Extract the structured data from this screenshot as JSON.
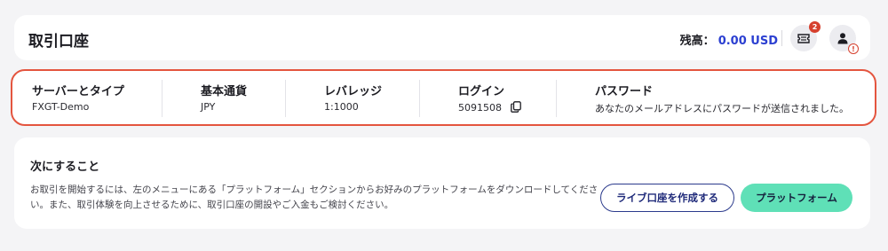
{
  "header": {
    "title": "取引口座",
    "balance_label": "残高：",
    "balance_amount": "0.00 USD",
    "notification_count": "2",
    "account_alert": "!",
    "colors": {
      "accent": "#2b3fd1",
      "badge": "#d6402e"
    }
  },
  "account": {
    "highlight_color": "#e4553f",
    "fields": [
      {
        "label": "サーバーとタイプ",
        "value": "FXGT-Demo"
      },
      {
        "label": "基本通貨",
        "value": "JPY"
      },
      {
        "label": "レバレッジ",
        "value": "1:1000"
      },
      {
        "label": "ログイン",
        "value": "5091508"
      },
      {
        "label": "パスワード",
        "value": "あなたのメールアドレスにパスワードが送信されました。"
      }
    ]
  },
  "next_steps": {
    "heading": "次にすること",
    "description": "お取引を開始するには、左のメニューにある「プラットフォーム」セクションからお好みのプラットフォームをダウンロードしてください。また、取引体験を向上させるために、取引口座の開設やご入金もご検討ください。",
    "create_live_button": "ライブ口座を作成する",
    "platform_button": "プラットフォーム",
    "colors": {
      "primary_button": "#5fe0b7",
      "outline_button": "#2b3a8c"
    }
  }
}
